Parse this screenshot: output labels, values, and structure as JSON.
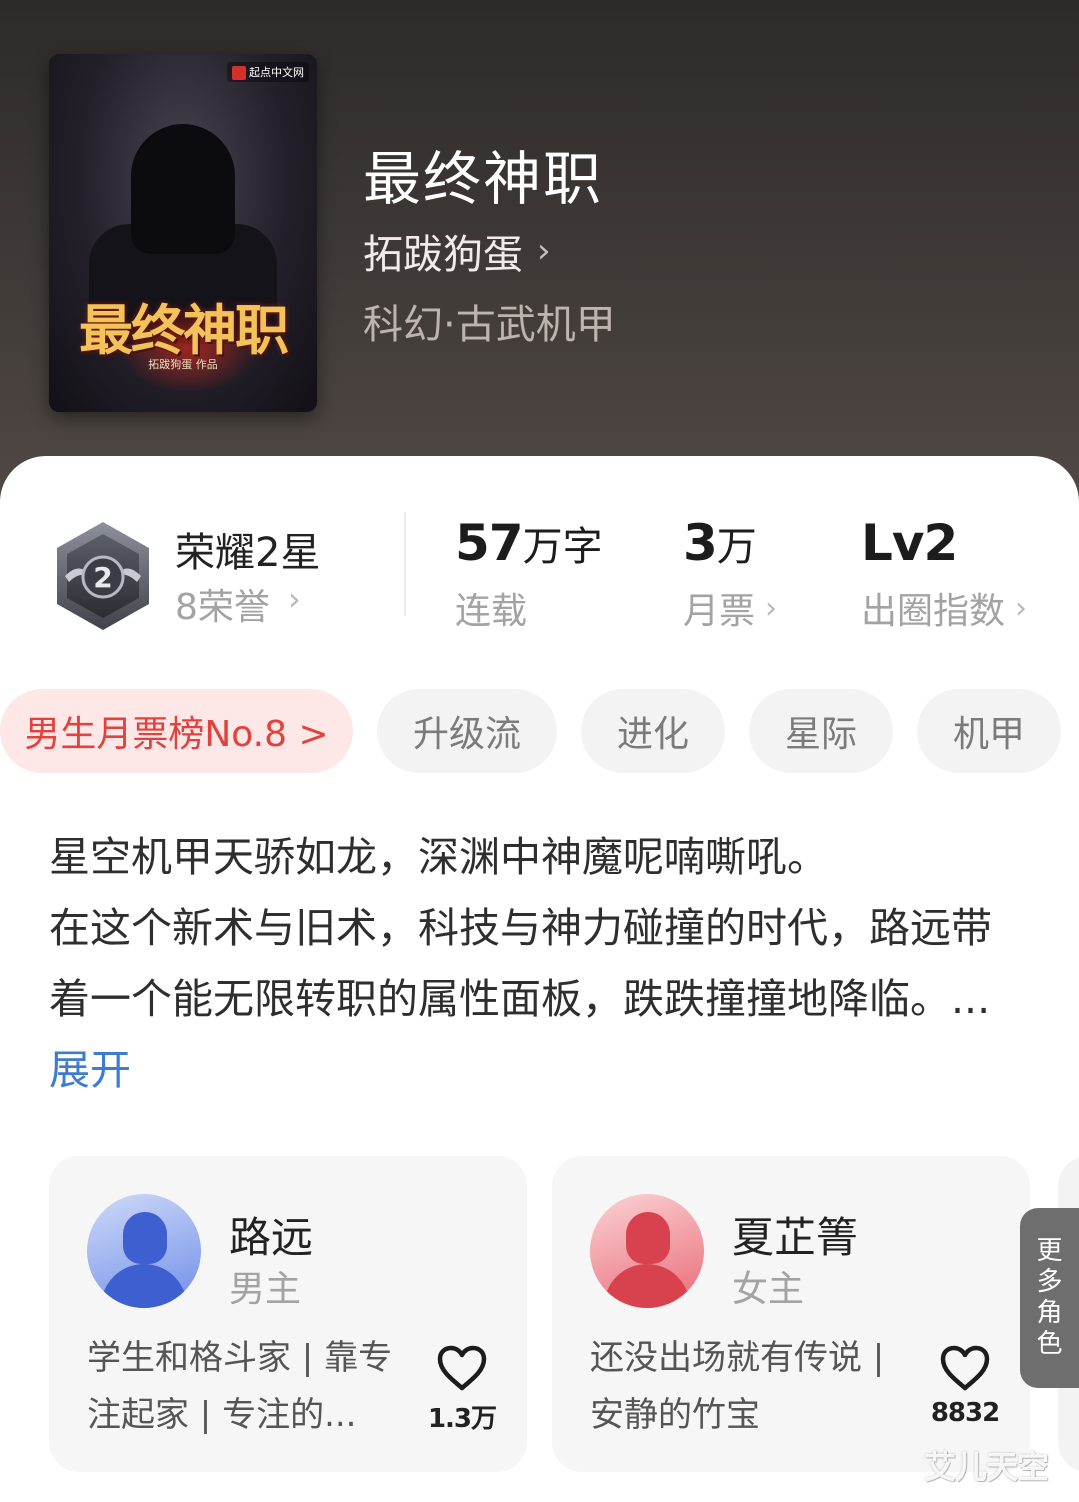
{
  "book": {
    "title": "最终神职",
    "author": "拓跋狗蛋",
    "genre": "科幻·古武机甲",
    "cover": {
      "publisher": "起点中文网",
      "title_art": "最终神职",
      "author_line": "拓跋狗蛋 作品"
    }
  },
  "honor": {
    "title": "荣耀2星",
    "subtitle": "8荣誉",
    "badge_level": "2",
    "chevron": "›"
  },
  "stats": [
    {
      "value": "57",
      "unit": "万字",
      "label": "连载",
      "chevron": ""
    },
    {
      "value": "3",
      "unit": "万",
      "label": "月票",
      "chevron": "›"
    },
    {
      "value": "Lv2",
      "unit": "",
      "label": "出圈指数",
      "chevron": "›"
    }
  ],
  "tags": {
    "rank": "男生月票榜No.8 >",
    "items": [
      "升级流",
      "进化",
      "星际",
      "机甲"
    ]
  },
  "synopsis": {
    "line1": "星空机甲天骄如龙，深渊中神魔呢喃嘶吼。",
    "line2": "在这个新术与旧术，科技与神力碰撞的时代，路远带着一个能无限转职的属性面板，跌跌撞撞地降临。",
    "ellipsis": "...",
    "expand_label": "展开"
  },
  "characters": [
    {
      "name": "路远",
      "role": "男主",
      "desc": "学生和格斗家 | 靠专注起家 | 专注的...",
      "likes": "1.3万"
    },
    {
      "name": "夏芷箐",
      "role": "女主",
      "desc": "还没出场就有传说 | 安静的竹宝",
      "likes": "8832"
    }
  ],
  "more_roles": [
    "更",
    "多",
    "角",
    "色"
  ],
  "watermark": "艾儿天空",
  "colors": {
    "accent_red": "#e1423d",
    "rank_bg": "#fde7e7",
    "link_blue": "#3e7ccf",
    "more_roles_bg": "#6e6e6e"
  }
}
